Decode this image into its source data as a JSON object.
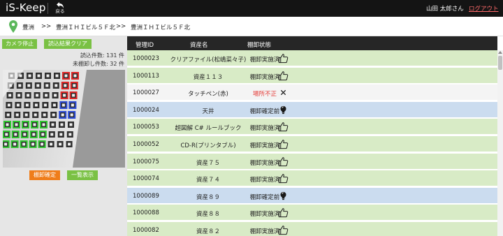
{
  "app": {
    "title": "iS-Keep",
    "back_label": "戻る"
  },
  "user": {
    "name": "山田 太郎さん",
    "logout_label": "ログアウト"
  },
  "breadcrumb": [
    "豊洲",
    "豊洲ＩＨＩビル５Ｆ北",
    "豊洲ＩＨＩビル５Ｆ北"
  ],
  "breadcrumb_sep": ">>",
  "left_panel": {
    "stop_camera_label": "カメラ停止",
    "clear_results_label": "読込結果クリア",
    "read_count_label": "読込件数: 131 件",
    "unchecked_count_label": "未棚卸し件数: 32 件",
    "confirm_button_label": "棚卸確定",
    "list_button_label": "一覧表示"
  },
  "colors": {
    "ok_row": "#d8ebc6",
    "pending_row": "#cbdcef",
    "warn_row": "#f4f4f4",
    "accent_green": "#7ac144",
    "accent_orange": "#ef7d1a",
    "logout_red": "#ff6a6a"
  },
  "table": {
    "headers": {
      "id": "管理ID",
      "name": "資産名",
      "status": "棚卸状態"
    },
    "rows": [
      {
        "id": "1000023",
        "name": "クリアファイル(松嶋菜々子)",
        "status": "棚卸実施済",
        "state": "ok",
        "icon": "thumbs-up-icon"
      },
      {
        "id": "1000113",
        "name": "資産１１３",
        "status": "棚卸実施済",
        "state": "ok",
        "icon": "thumbs-up-icon"
      },
      {
        "id": "1000027",
        "name": "タッチペン(赤)",
        "status": "場所不正",
        "state": "warn",
        "icon": "cross-icon"
      },
      {
        "id": "1000024",
        "name": "天井",
        "status": "棚卸確定前",
        "state": "pending",
        "icon": "lightbulb-icon"
      },
      {
        "id": "1000053",
        "name": "超図解 C# ルールブック",
        "status": "棚卸実施済",
        "state": "ok",
        "icon": "thumbs-up-icon"
      },
      {
        "id": "1000052",
        "name": "CD-R(プリンタブル)",
        "status": "棚卸実施済",
        "state": "ok",
        "icon": "thumbs-up-icon"
      },
      {
        "id": "1000075",
        "name": "資産７５",
        "status": "棚卸実施済",
        "state": "ok",
        "icon": "thumbs-up-icon"
      },
      {
        "id": "1000074",
        "name": "資産７４",
        "status": "棚卸実施済",
        "state": "ok",
        "icon": "thumbs-up-icon"
      },
      {
        "id": "1000089",
        "name": "資産８９",
        "status": "棚卸確定前",
        "state": "pending",
        "icon": "lightbulb-icon"
      },
      {
        "id": "1000088",
        "name": "資産８８",
        "status": "棚卸実施済",
        "state": "ok",
        "icon": "thumbs-up-icon"
      },
      {
        "id": "1000082",
        "name": "資産８２",
        "status": "棚卸実施済",
        "state": "ok",
        "icon": "thumbs-up-icon"
      }
    ]
  }
}
